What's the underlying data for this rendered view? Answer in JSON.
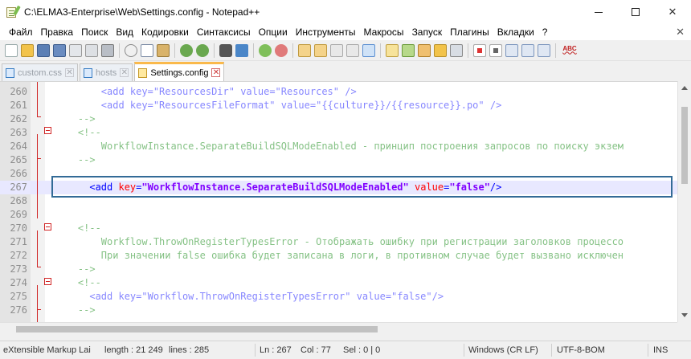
{
  "window": {
    "title": "C:\\ELMA3-Enterprise\\Web\\Settings.config - Notepad++",
    "minimize_glyph": "—",
    "maximize_glyph": "□",
    "close_glyph": "✕"
  },
  "menu": {
    "items": [
      "Файл",
      "Правка",
      "Поиск",
      "Вид",
      "Кодировки",
      "Синтаксисы",
      "Опции",
      "Инструменты",
      "Макросы",
      "Запуск",
      "Плагины",
      "Вкладки",
      "?"
    ],
    "close_glyph": "✕"
  },
  "toolbar": {
    "icons": [
      "new-file-icon",
      "open-file-icon",
      "save-icon",
      "save-all-icon",
      "close-icon",
      "close-all-icon",
      "print-icon",
      "cut-icon",
      "copy-icon",
      "paste-icon",
      "undo-icon",
      "redo-icon",
      "find-icon",
      "replace-icon",
      "zoom-in-icon",
      "zoom-out-icon",
      "sync-vertical-icon",
      "sync-horizontal-icon",
      "word-wrap-icon",
      "show-all-chars-icon",
      "indent-guide-icon",
      "user-lang-icon",
      "doc-map-icon",
      "function-list-icon",
      "folder-workspace-icon",
      "monitor-icon",
      "record-macro-icon",
      "stop-macro-icon",
      "play-macro-icon",
      "run-macro-multiple-icon",
      "save-macro-icon",
      "spell-check-icon"
    ],
    "spell_label": "ABC"
  },
  "tabs": [
    {
      "label": "custom.css",
      "active": false
    },
    {
      "label": "hosts",
      "active": false
    },
    {
      "label": "Settings.config",
      "active": true
    }
  ],
  "tab_close_glyph": "✕",
  "editor": {
    "lines": [
      {
        "num": "260",
        "indent": "        ",
        "parts": [
          {
            "t": "<add ",
            "c": "tag"
          },
          {
            "t": "key=\"ResourcesDir\" value=\"Resources\" />",
            "c": "tag"
          }
        ],
        "faded": true
      },
      {
        "num": "261",
        "indent": "        ",
        "parts": [
          {
            "t": "<add key=\"ResourcesFileFormat\" value=\"{{culture}}/{{resource}}.po\" />",
            "c": "tag"
          }
        ],
        "faded": true
      },
      {
        "num": "262",
        "indent": "    ",
        "parts": [
          {
            "t": "-->",
            "c": "comment"
          }
        ],
        "faded": true
      },
      {
        "num": "263",
        "indent": "    ",
        "parts": [
          {
            "t": "<!--",
            "c": "comment"
          }
        ],
        "faded": true
      },
      {
        "num": "264",
        "indent": "        ",
        "parts": [
          {
            "t": "WorkflowInstance.SeparateBuildSQLModeEnabled - принцип построения запросов по поиску экзем",
            "c": "comment"
          }
        ],
        "faded": true
      },
      {
        "num": "265",
        "indent": "    ",
        "parts": [
          {
            "t": "-->",
            "c": "comment"
          }
        ],
        "faded": true
      },
      {
        "num": "266",
        "indent": "",
        "parts": [],
        "faded": true
      },
      {
        "num": "267",
        "indent": "      ",
        "parts": [
          {
            "t": "<add ",
            "c": "tag"
          },
          {
            "t": "key",
            "c": "attr"
          },
          {
            "t": "=",
            "c": "tag"
          },
          {
            "t": "\"WorkflowInstance.SeparateBuildSQLModeEnabled\"",
            "c": "val"
          },
          {
            "t": " ",
            "c": "tag"
          },
          {
            "t": "value",
            "c": "attr"
          },
          {
            "t": "=",
            "c": "tag"
          },
          {
            "t": "\"false\"",
            "c": "val"
          },
          {
            "t": "/>",
            "c": "tag"
          }
        ],
        "faded": false,
        "current": true
      },
      {
        "num": "268",
        "indent": "",
        "parts": [],
        "faded": true
      },
      {
        "num": "269",
        "indent": "",
        "parts": [],
        "faded": true
      },
      {
        "num": "270",
        "indent": "    ",
        "parts": [
          {
            "t": "<!--",
            "c": "comment"
          }
        ],
        "faded": true
      },
      {
        "num": "271",
        "indent": "        ",
        "parts": [
          {
            "t": "Workflow.ThrowOnRegisterTypesError - Отображать ошибку при регистрации заголовков процессо",
            "c": "comment"
          }
        ],
        "faded": true
      },
      {
        "num": "272",
        "indent": "        ",
        "parts": [
          {
            "t": "При значении false ошибка будет записана в логи, в противном случае будет вызвано исключен",
            "c": "comment"
          }
        ],
        "faded": true
      },
      {
        "num": "273",
        "indent": "    ",
        "parts": [
          {
            "t": "-->",
            "c": "comment"
          }
        ],
        "faded": true
      },
      {
        "num": "274",
        "indent": "    ",
        "parts": [
          {
            "t": "<!--",
            "c": "comment"
          }
        ],
        "faded": true
      },
      {
        "num": "275",
        "indent": "      ",
        "parts": [
          {
            "t": "<add key=\"Workflow.ThrowOnRegisterTypesError\" value=\"false\"/>",
            "c": "tag"
          }
        ],
        "faded": true
      },
      {
        "num": "276",
        "indent": "    ",
        "parts": [
          {
            "t": "-->",
            "c": "comment"
          }
        ],
        "faded": true
      }
    ]
  },
  "status": {
    "lang": "eXtensible Markup Lai",
    "length": "length : 21 249",
    "lines": "lines : 285",
    "ln": "Ln : 267",
    "col": "Col : 77",
    "sel": "Sel : 0 | 0",
    "eol": "Windows (CR LF)",
    "encoding": "UTF-8-BOM",
    "mode": "INS"
  },
  "colors": {
    "accent_tab": "#fab94b",
    "highlight_border": "#336b97",
    "current_line": "#e8e8ff",
    "fold_marker": "#d02525"
  }
}
